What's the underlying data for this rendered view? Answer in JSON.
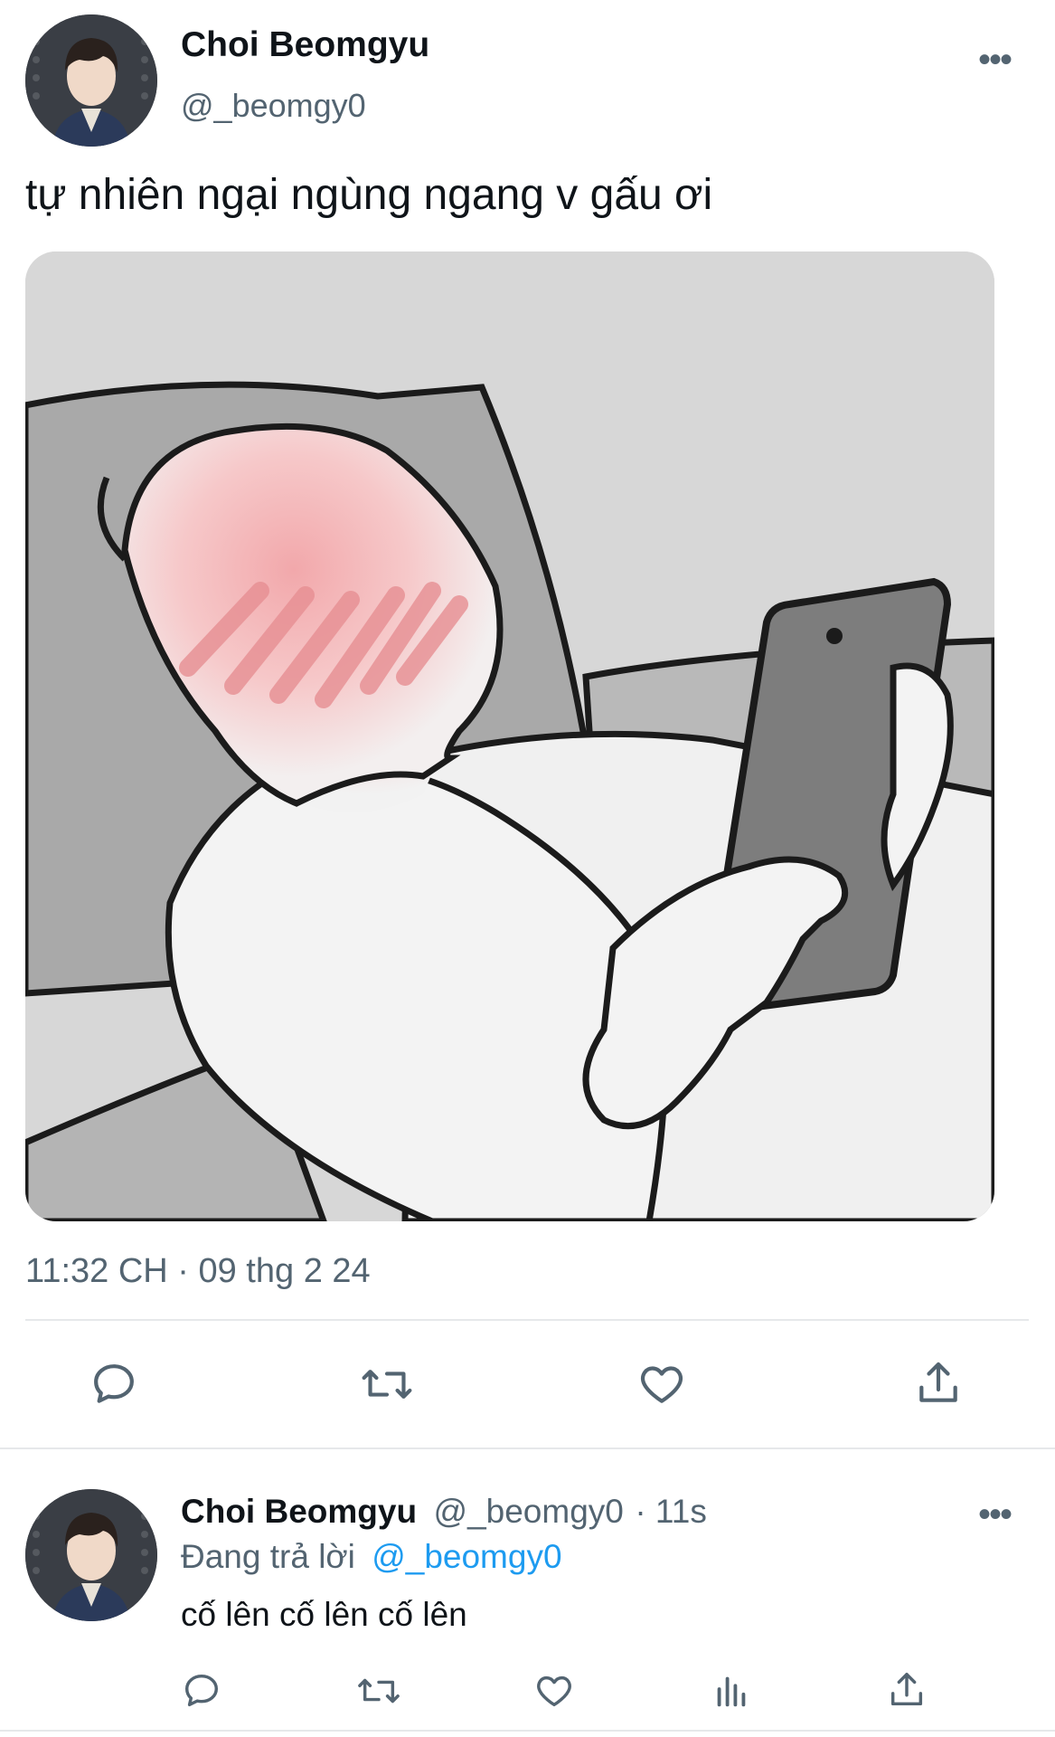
{
  "tweet": {
    "author_name": "Choi Beomgyu",
    "author_handle": "@_beomgy0",
    "more_label": "•••",
    "text": "tự nhiên ngại ngùng ngang v gấu ơi",
    "timestamp": "11:32 CH · 09 thg 2 24",
    "media_icon": "meme-illustration"
  },
  "actions": [
    "reply-icon",
    "retweet-icon",
    "like-icon",
    "share-icon"
  ],
  "reply": {
    "author_name": "Choi Beomgyu",
    "author_handle": "@_beomgy0",
    "time": "· 11s",
    "replying_prefix": "Đang trả lời",
    "replying_to": "@_beomgy0",
    "text": "cố lên cố lên cố lên",
    "more_label": "•••",
    "actions": [
      "reply-icon",
      "retweet-icon",
      "like-icon",
      "analytics-icon",
      "share-icon"
    ]
  },
  "colors": {
    "text": "#0f1419",
    "secondary": "#536471",
    "link": "#1d9bf0",
    "divider": "#e6e8ea"
  }
}
